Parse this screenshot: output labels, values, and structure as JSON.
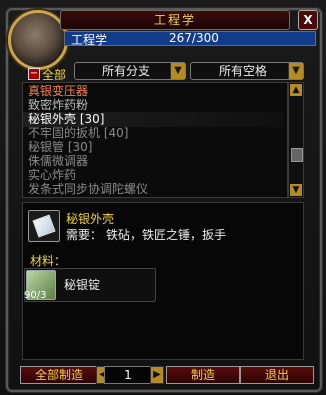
{
  "window": {
    "title": "工程学",
    "close_label": "X"
  },
  "skill": {
    "name": "工程学",
    "value": "267/300"
  },
  "filters": {
    "all_label": "全部",
    "subclass": "所有分支",
    "slots": "所有空格"
  },
  "recipes": [
    {
      "name": "真银变压器",
      "state": "orange"
    },
    {
      "name": "致密炸药粉",
      "state": "normal"
    },
    {
      "name": "秘银外壳 [30]",
      "state": "selected"
    },
    {
      "name": "不牢固的扳机 [40]",
      "state": "grey"
    },
    {
      "name": "秘银管 [30]",
      "state": "grey"
    },
    {
      "name": "侏儒微调器",
      "state": "grey"
    },
    {
      "name": "实心炸药",
      "state": "grey"
    },
    {
      "name": "发条式同步协调陀螺仪",
      "state": "grey"
    }
  ],
  "detail": {
    "item_name": "秘银外壳",
    "requires_label": "需要：",
    "requires_value": "铁砧，铁匠之锤，扳手",
    "materials_label": "材料：",
    "material": {
      "name": "秘银锭",
      "count": "90/3"
    }
  },
  "buttons": {
    "craft_all": "全部制造",
    "craft": "制造",
    "exit": "退出"
  },
  "quantity": "1",
  "colors": {
    "gold": "#f0d23a",
    "orange": "#ff8040",
    "grey": "#8a8a8a"
  }
}
